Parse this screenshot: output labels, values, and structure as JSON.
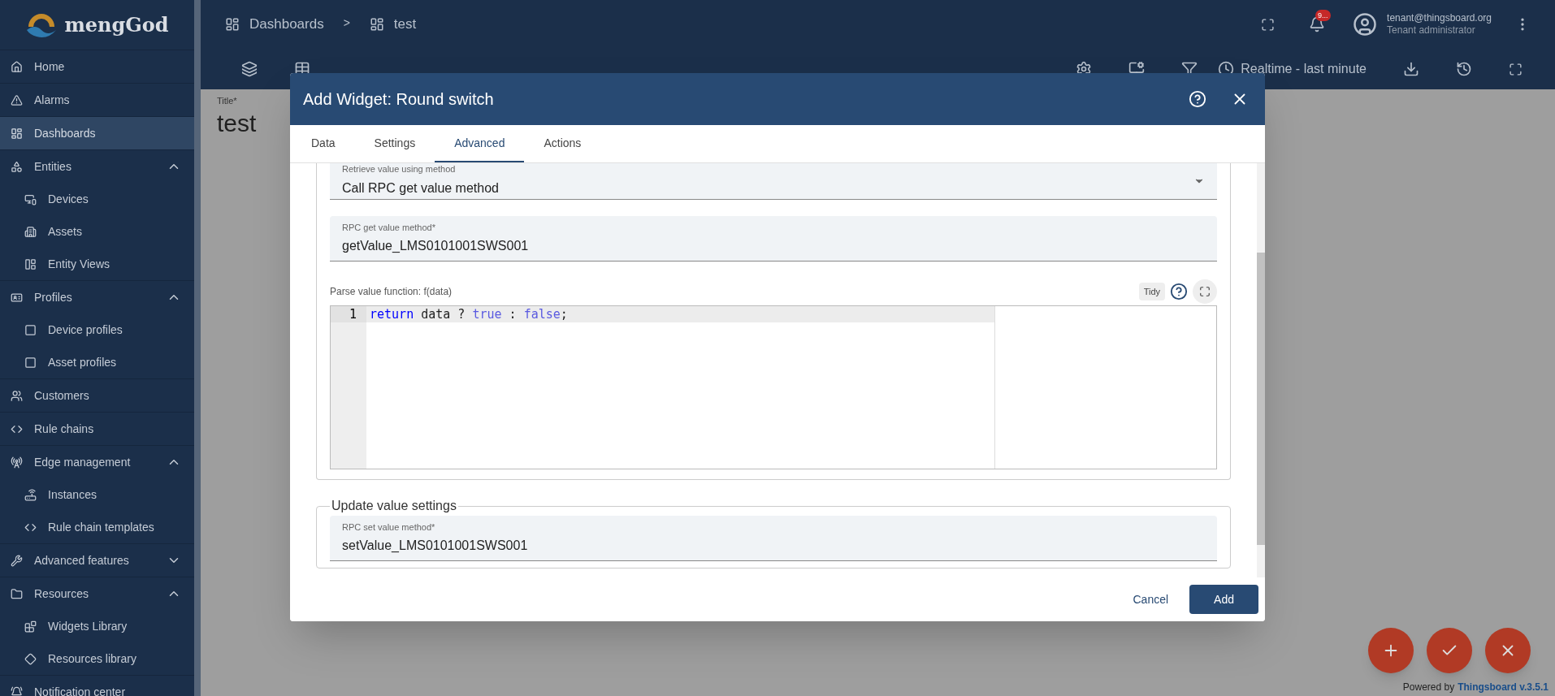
{
  "logo": {
    "text": "mengGod"
  },
  "sidebar": {
    "items": [
      {
        "label": "Home",
        "selected": false
      },
      {
        "label": "Alarms",
        "selected": false
      },
      {
        "label": "Dashboards",
        "selected": true
      },
      {
        "label": "Entities",
        "selected": false,
        "expanded": true,
        "children": [
          {
            "label": "Devices",
            "selected": false
          },
          {
            "label": "Assets",
            "selected": false
          },
          {
            "label": "Entity Views",
            "selected": false
          }
        ]
      },
      {
        "label": "Profiles",
        "selected": false,
        "expanded": true,
        "children": [
          {
            "label": "Device profiles",
            "selected": false
          },
          {
            "label": "Asset profiles",
            "selected": false
          }
        ]
      },
      {
        "label": "Customers",
        "selected": false
      },
      {
        "label": "Rule chains",
        "selected": false
      },
      {
        "label": "Edge management",
        "selected": false,
        "expanded": true,
        "children": [
          {
            "label": "Instances",
            "selected": false
          },
          {
            "label": "Rule chain templates",
            "selected": false
          }
        ]
      },
      {
        "label": "Advanced features",
        "selected": false,
        "expanded": false
      },
      {
        "label": "Resources",
        "selected": false,
        "expanded": true,
        "children": [
          {
            "label": "Widgets Library",
            "selected": false
          },
          {
            "label": "Resources library",
            "selected": false
          }
        ]
      },
      {
        "label": "Notification center",
        "selected": false
      }
    ]
  },
  "breadcrumb": [
    "Dashboards",
    "test"
  ],
  "breadcrumb_separator": ">",
  "notifications": {
    "badge": "9..."
  },
  "user": {
    "email": "tenant@thingsboard.org",
    "role": "Tenant administrator"
  },
  "timewindow": {
    "label": "Realtime - last minute"
  },
  "dashboard": {
    "title_label": "Title*",
    "title": "test"
  },
  "dialog": {
    "title": "Add Widget: Round switch",
    "tabs": [
      {
        "label": "Data",
        "selected": false
      },
      {
        "label": "Settings",
        "selected": false
      },
      {
        "label": "Advanced",
        "selected": true
      },
      {
        "label": "Actions",
        "selected": false
      }
    ],
    "retrieve_select": {
      "label": "Retrieve value using method",
      "value": "Call RPC get value method"
    },
    "get_method": {
      "label": "RPC get value method*",
      "value": "getValue_LMS0101001SWS001"
    },
    "parse_function": {
      "label": "Parse value function: f(data)",
      "tidy": "Tidy",
      "lines": [
        {
          "number": "1",
          "tokens": [
            {
              "text": "return",
              "kind": "keyword"
            },
            {
              "text": " data ? ",
              "kind": "plain"
            },
            {
              "text": "true",
              "kind": "atom"
            },
            {
              "text": " : ",
              "kind": "plain"
            },
            {
              "text": "false",
              "kind": "atom"
            },
            {
              "text": ";",
              "kind": "plain"
            }
          ]
        }
      ]
    },
    "update_section": {
      "legend": "Update value settings"
    },
    "set_method": {
      "label": "RPC set value method*",
      "value": "setValue_LMS0101001SWS001"
    },
    "cancel": "Cancel",
    "add": "Add"
  },
  "footer": {
    "prefix": "Powered by",
    "link": "Thingsboard v.3.5.1"
  }
}
